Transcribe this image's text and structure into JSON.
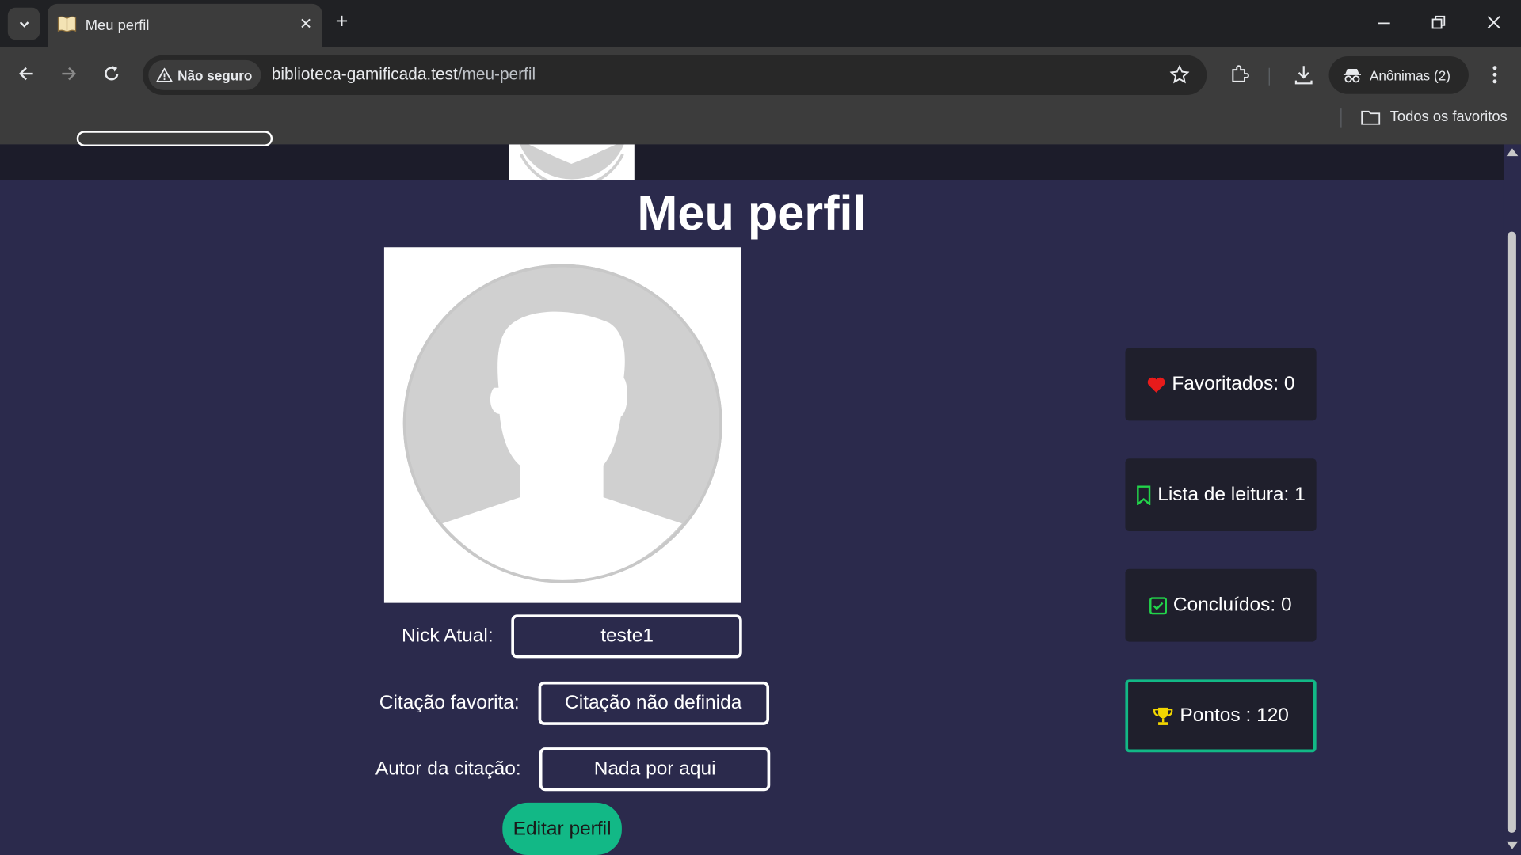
{
  "browser": {
    "tab_title": "Meu perfil",
    "security_label": "Não seguro",
    "url_host": "biblioteca-gamificada.test",
    "url_path": "/meu-perfil",
    "profile_label": "Anônimas (2)",
    "bookmarks_all": "Todos os favoritos"
  },
  "page": {
    "title": "Meu perfil",
    "fields": [
      {
        "label": "Nick Atual:",
        "value": "teste1"
      },
      {
        "label": "Citação favorita:",
        "value": "Citação não definida"
      },
      {
        "label": "Autor da citação:",
        "value": "Nada por aqui"
      }
    ],
    "edit_button": "Editar perfil"
  },
  "stats": [
    {
      "label": "Favoritados: 0",
      "icon": "heart-icon",
      "color": "#e81b1b"
    },
    {
      "label": "Lista de leitura: 1",
      "icon": "bookmark-icon",
      "color": "#22d34a"
    },
    {
      "label": "Concluídos: 0",
      "icon": "check-square-icon",
      "color": "#22d34a"
    },
    {
      "label": "Pontos : 120",
      "icon": "trophy-icon",
      "color": "#f2d600"
    }
  ],
  "colors": {
    "page_bg": "#2b2a4c",
    "accent": "#12b886",
    "card_bg": "#1f1f2c"
  }
}
